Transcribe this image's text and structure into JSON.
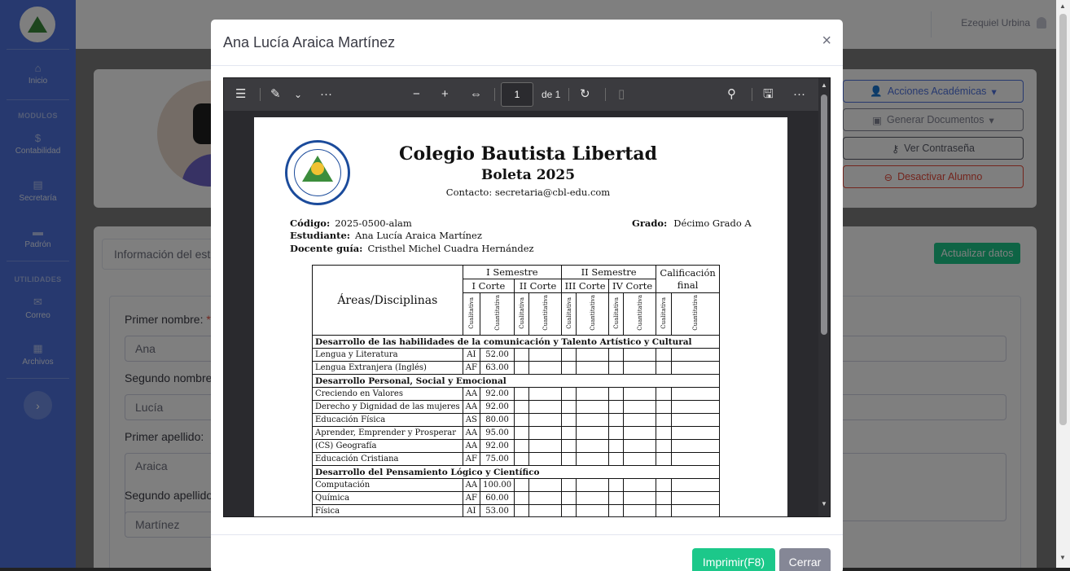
{
  "sidebar": {
    "items": [
      {
        "label": "Inicio",
        "icon": "home-icon",
        "glyph": "⌂"
      },
      {
        "label": "Contabilidad",
        "icon": "dollar-icon",
        "glyph": "$"
      },
      {
        "label": "Secretaría",
        "icon": "clipboard-icon",
        "glyph": "▤"
      },
      {
        "label": "Padrón",
        "icon": "folder-icon",
        "glyph": "▬"
      },
      {
        "label": "Correo",
        "icon": "envelope-icon",
        "glyph": "✉"
      },
      {
        "label": "Archivos",
        "icon": "archive-icon",
        "glyph": "▦"
      }
    ],
    "headings": [
      "MODULOS",
      "UTILIDADES"
    ],
    "toggle_glyph": "›"
  },
  "topbar": {
    "user_name": "Ezequiel Urbina"
  },
  "profile": {
    "actions": [
      {
        "label": "Acciones Académicas",
        "icon": "user-graduate-icon",
        "glyph": "👤",
        "caret": "▾"
      },
      {
        "label": "Generar Documentos",
        "icon": "file-export-icon",
        "glyph": "▣",
        "caret": "▾"
      },
      {
        "label": "Ver Contraseña",
        "icon": "key-icon",
        "glyph": "⚷"
      },
      {
        "label": "Desactivar Alumno",
        "icon": "toggle-off-icon",
        "glyph": "⊖"
      }
    ]
  },
  "student_form": {
    "tab_label": "Información del estudiante",
    "update_button": "Actualizar datos",
    "fields": [
      {
        "label": "Primer nombre:",
        "required": "*",
        "value": "Ana"
      },
      {
        "label": "Segundo nombre",
        "value": "Lucía"
      },
      {
        "label": "Primer apellido:",
        "value": "Araica"
      },
      {
        "label": "Segundo apellido",
        "value": "Martínez"
      }
    ]
  },
  "modal": {
    "title": "Ana Lucía Araica Martínez",
    "close_glyph": "×",
    "print_button": "Imprimir(F8)",
    "close_button": "Cerrar"
  },
  "viewer": {
    "page_number": "1",
    "page_total": "de 1",
    "glyphs": {
      "toc": "☰",
      "draw": "✎",
      "caret": "⌄",
      "more": "···",
      "minus": "−",
      "plus": "+",
      "fit": "⇔",
      "rotate": "↻",
      "twopage": "▯",
      "search": "⚲",
      "save": "🖫"
    }
  },
  "document": {
    "school": "Colegio Bautista Libertad",
    "subtitle": "Boleta 2025",
    "contact": "Contacto: secretaria@cbl-edu.com",
    "code_label": "Código:",
    "code": "2025-0500-alam",
    "grade_label": "Grado:",
    "grade": "Décimo Grado A",
    "student_label": "Estudiante:",
    "student": "Ana Lucía Araica Martínez",
    "teacher_label": "Docente guía:",
    "teacher": "Cristhel Michel Cuadra Hernández",
    "table": {
      "areas_header": "Áreas/Disciplinas",
      "sem1": "I Semestre",
      "sem2": "II Semestre",
      "final": "Calificación final",
      "cut1": "I Corte",
      "cut2": "II Corte",
      "cut3": "III Corte",
      "cut4": "IV Corte",
      "qual": "Cualitativa",
      "quant": "Cuantitativa",
      "sections": [
        {
          "title": "Desarrollo de las habilidades de la comunicación y Talento Artístico y Cultural",
          "rows": [
            [
              "Lengua y Literatura",
              "AI",
              "52.00"
            ],
            [
              "Lengua Extranjera (Inglés)",
              "AF",
              "63.00"
            ]
          ]
        },
        {
          "title": "Desarrollo Personal, Social y Emocional",
          "rows": [
            [
              "Creciendo en Valores",
              "AA",
              "92.00"
            ],
            [
              "Derecho y Dignidad de las mujeres",
              "AA",
              "92.00"
            ],
            [
              "Educación Física",
              "AS",
              "80.00"
            ],
            [
              "Aprender, Emprender y Prosperar",
              "AA",
              "95.00"
            ],
            [
              "(CS) Geografía",
              "AA",
              "92.00"
            ],
            [
              "Educación Cristiana",
              "AF",
              "75.00"
            ]
          ]
        },
        {
          "title": "Desarrollo del Pensamiento Lógico y Científico",
          "rows": [
            [
              "Computación",
              "AA",
              "100.00"
            ],
            [
              "Química",
              "AF",
              "60.00"
            ],
            [
              "Física",
              "AI",
              "53.00"
            ]
          ]
        }
      ]
    }
  }
}
